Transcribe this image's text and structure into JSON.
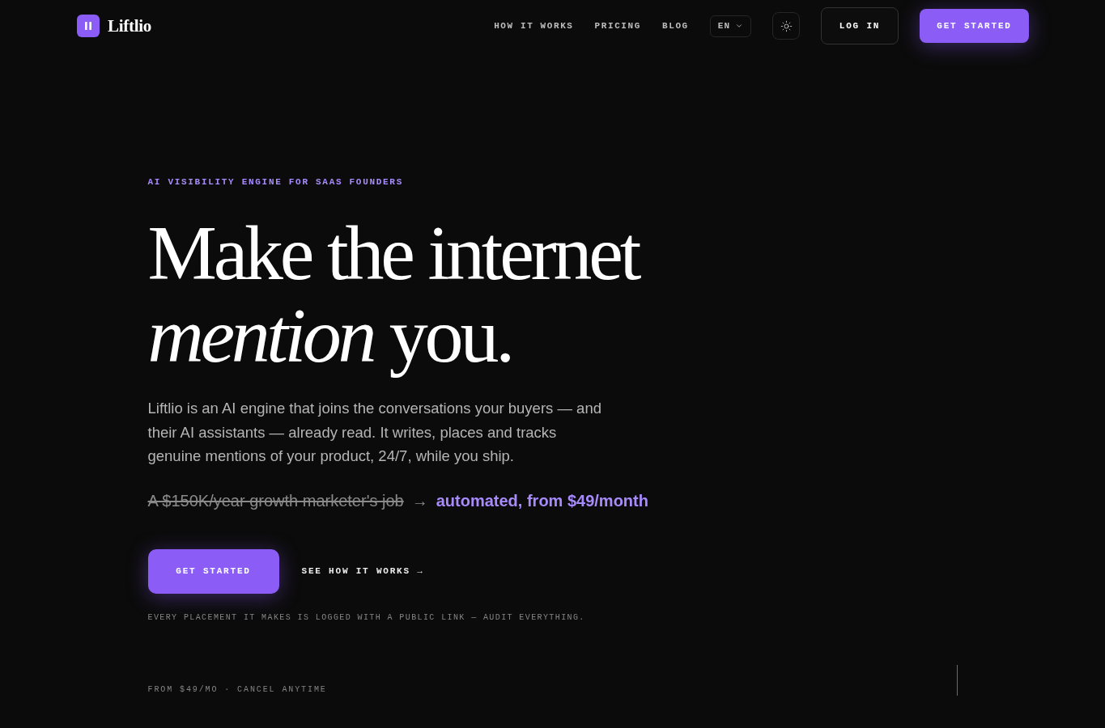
{
  "nav": {
    "brand": "Liftlio",
    "links": [
      "HOW IT WORKS",
      "PRICING",
      "BLOG"
    ],
    "language": "EN",
    "login": "LOG IN",
    "cta": "GET STARTED"
  },
  "hero": {
    "eyebrow": "AI VISIBILITY ENGINE FOR SAAS FOUNDERS",
    "headline": "Make the internet *mention* you.",
    "description": "Liftlio is an AI engine that joins the conversations your buyers — and their AI assistants — already read. It writes, places and tracks genuine mentions of your product, 24/7, while you ship.",
    "comparison": {
      "old": "A $150K/year growth marketer's job",
      "arrow": "→",
      "new": "automated, from $49/month"
    },
    "primary_button": "GET STARTED",
    "secondary_link": "SEE HOW IT WORKS →",
    "note": "EVERY PLACEMENT IT MAKES IS LOGGED WITH A PUBLIC LINK — AUDIT EVERYTHING."
  },
  "footer_note": "FROM $49/MO · CANCEL ANYTIME"
}
